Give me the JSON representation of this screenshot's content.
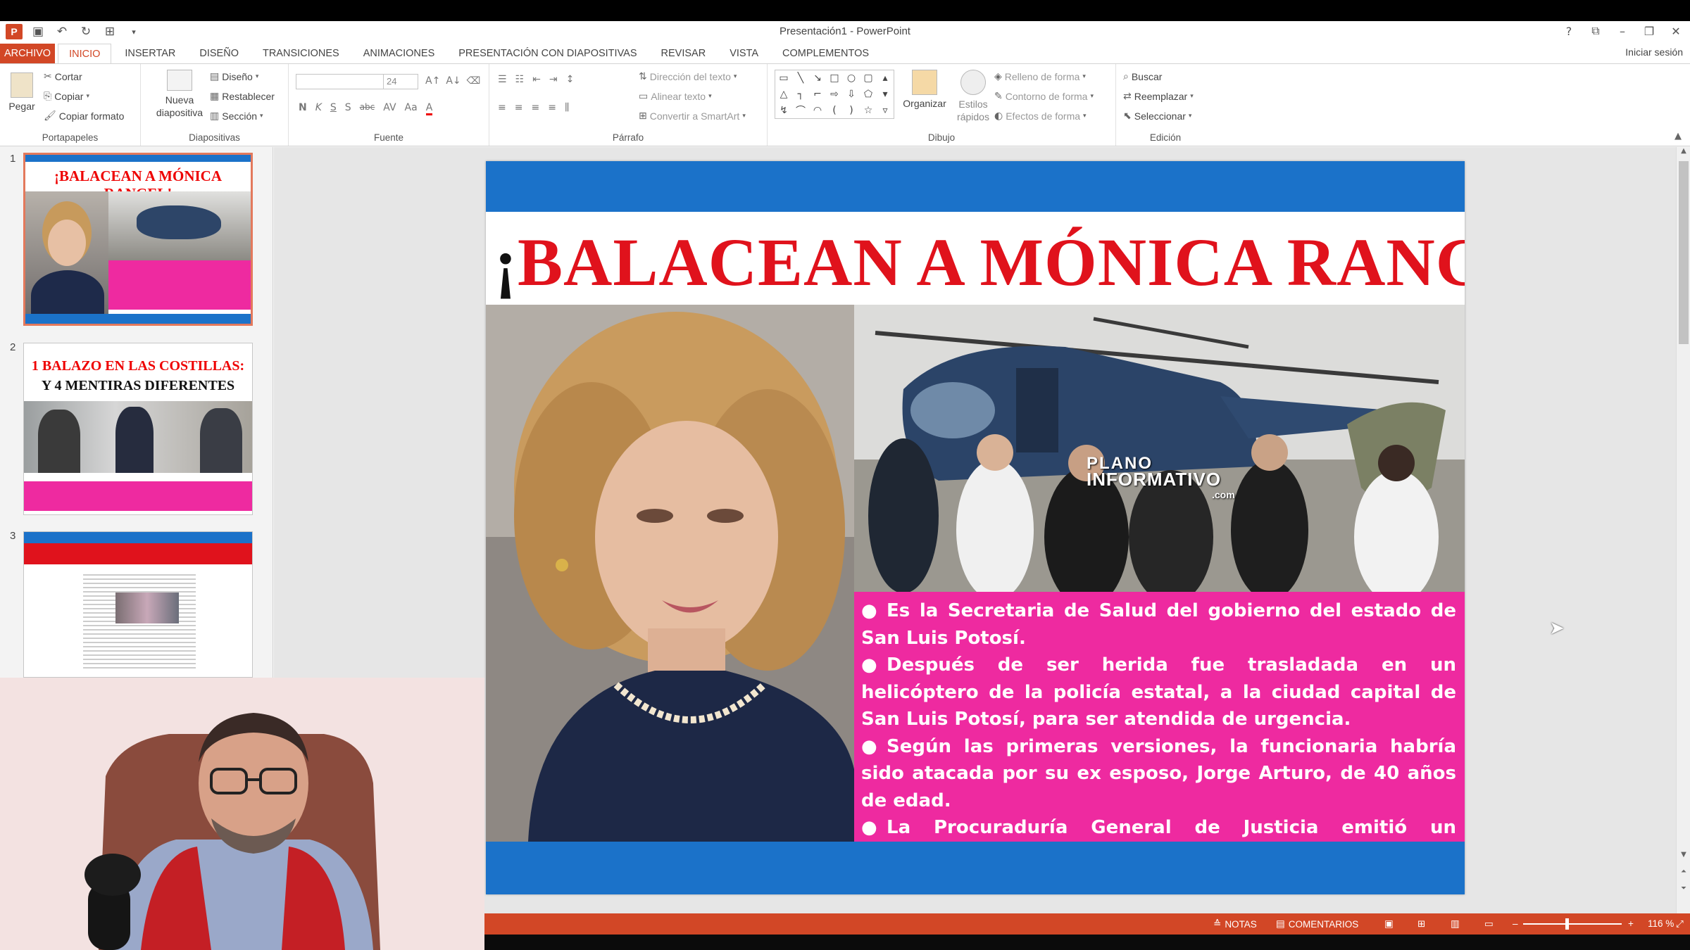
{
  "window": {
    "title": "Presentación1 - PowerPoint",
    "sign_in": "Iniciar sesión"
  },
  "qat": {
    "logo": "P",
    "save": "save-icon",
    "undo": "undo-icon",
    "redo": "redo-icon",
    "customize": "customize-icon"
  },
  "tabs": {
    "file": "ARCHIVO",
    "items": [
      "INICIO",
      "INSERTAR",
      "DISEÑO",
      "TRANSICIONES",
      "ANIMACIONES",
      "PRESENTACIÓN CON DIAPOSITIVAS",
      "REVISAR",
      "VISTA",
      "COMPLEMENTOS"
    ]
  },
  "ribbon": {
    "clipboard": {
      "label": "Portapapeles",
      "paste": "Pegar",
      "cut": "Cortar",
      "copy": "Copiar",
      "format_painter": "Copiar formato"
    },
    "slides": {
      "label": "Diapositivas",
      "new_slide_1": "Nueva",
      "new_slide_2": "diapositiva",
      "layout": "Diseño",
      "reset": "Restablecer",
      "section": "Sección"
    },
    "font": {
      "label": "Fuente",
      "size": "24",
      "bold": "N",
      "italic": "K",
      "underline": "S",
      "shadow": "S",
      "strike": "abc",
      "spacing": "AV",
      "case": "Aa",
      "color": "A"
    },
    "paragraph": {
      "label": "Párrafo",
      "text_direction": "Dirección del texto",
      "align_text": "Alinear texto",
      "smartart": "Convertir a SmartArt"
    },
    "drawing": {
      "label": "Dibujo",
      "arrange": "Organizar",
      "quick_styles_1": "Estilos",
      "quick_styles_2": "rápidos",
      "fill": "Relleno de forma",
      "outline": "Contorno de forma",
      "effects": "Efectos de forma"
    },
    "editing": {
      "label": "Edición",
      "find": "Buscar",
      "replace": "Reemplazar",
      "select": "Seleccionar"
    }
  },
  "thumbnails": [
    {
      "number": "1",
      "title": "¡BALACEAN A MÓNICA RANGEL!"
    },
    {
      "number": "2",
      "title_line1": "1 BALAZO EN LAS COSTILLAS:",
      "title_line2": "Y 4 MENTIRAS DIFERENTES"
    },
    {
      "number": "3"
    }
  ],
  "slide": {
    "headline_open": "¡",
    "headline": "BALACEAN A MÓNICA RANGEL",
    "headline_close": "!",
    "watermark_1": "PLANO",
    "watermark_2": "INFORMATIVO",
    "watermark_3": ".com",
    "bullets": [
      "Es la Secretaria de Salud del gobierno del estado de San Luis Potosí.",
      "Después de ser herida fue trasladada en un helicóptero de la policía estatal, a la ciudad capital de San Luis Potosí, para ser atendida de urgencia.",
      "Según las primeras versiones, la funcionaria habría sido atacada por su ex esposo, Jorge Arturo, de 40 años de edad.",
      "La Procuraduría General de Justicia emitió un comunicado de prensa, con la versión oficial de los hechos."
    ],
    "colors": {
      "band": "#1b72c9",
      "headline": "#e0121c",
      "bullets_bg": "#ee2aa0"
    }
  },
  "statusbar": {
    "notes": "NOTAS",
    "comments": "COMENTARIOS",
    "zoom": "116 %",
    "zoom_out": "–",
    "zoom_in": "+"
  }
}
